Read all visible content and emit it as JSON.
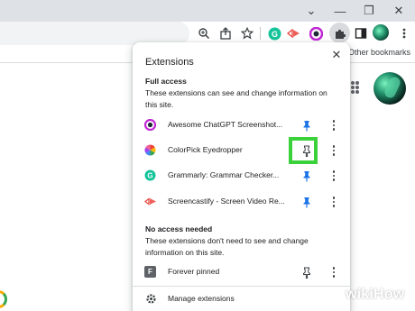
{
  "browser": {
    "window_controls": {
      "chevron": "⌄",
      "minimize": "—",
      "restore": "❐",
      "close": "✕"
    },
    "toolbar_icons": [
      "zoom-icon",
      "share-icon",
      "bookmark-star-icon",
      "grammarly-icon",
      "screencastify-icon",
      "chatgpt-screenshot-icon",
      "extensions-puzzle-icon",
      "side-panel-icon",
      "profile-avatar"
    ],
    "bookmarks": {
      "overflow": "»",
      "other": "Other bookmarks"
    }
  },
  "extensions_popup": {
    "title": "Extensions",
    "close_label": "✕",
    "full_access": {
      "heading": "Full access",
      "description": "These extensions can see and change information on this site.",
      "items": [
        {
          "name": "Awesome ChatGPT Screenshot...",
          "icon": "chatgpt-screenshot-icon",
          "pinned": true
        },
        {
          "name": "ColorPick Eyedropper",
          "icon": "colorpick-icon",
          "pinned": false,
          "highlighted": true
        },
        {
          "name": "Grammarly: Grammar Checker...",
          "icon": "grammarly-icon",
          "pinned": true
        },
        {
          "name": "Screencastify - Screen Video Re...",
          "icon": "screencastify-icon",
          "pinned": true
        }
      ]
    },
    "no_access": {
      "heading": "No access needed",
      "description": "These extensions don't need to see and change information on this site.",
      "items": [
        {
          "name": "Forever pinned",
          "icon": "forever-pinned-icon",
          "badge": "F",
          "pinned": false
        }
      ]
    },
    "manage_label": "Manage extensions"
  },
  "colors": {
    "highlight": "#3ad13a",
    "pin_blue": "#1a73e8",
    "grammarly": "#15c39a",
    "screencastify": "#e8453c"
  },
  "watermark": "wikiHow"
}
